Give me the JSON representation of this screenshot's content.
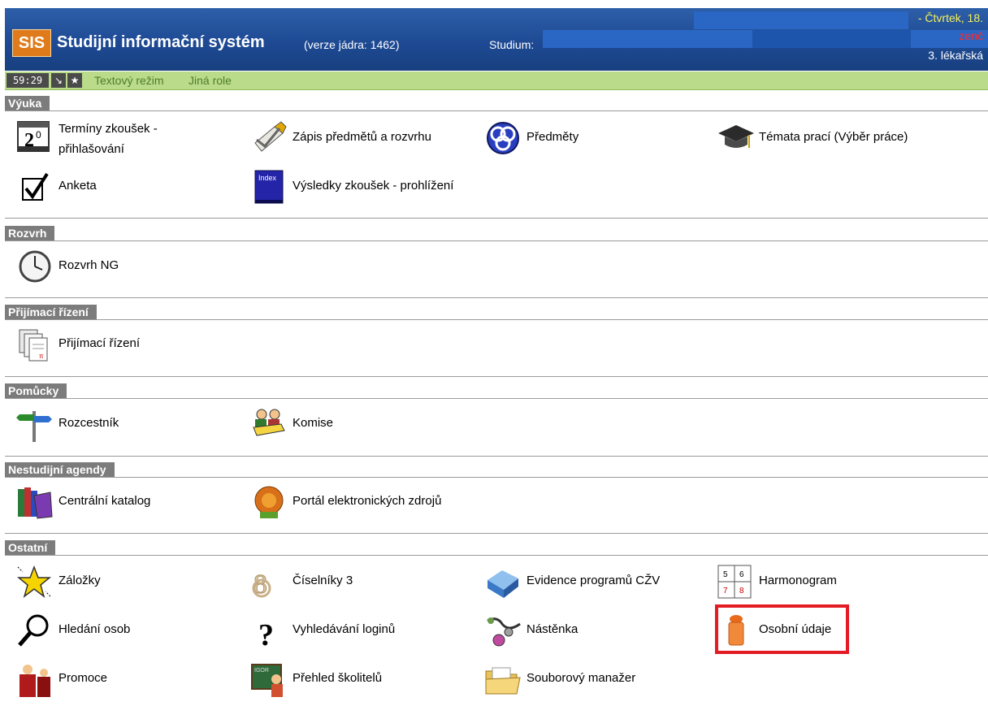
{
  "header": {
    "logo": "SIS",
    "title": "Studijní informační systém",
    "version": "(verze jádra: 1462)",
    "study_label": "Studium:",
    "date": "- Čtvrtek, 18.",
    "red_text": "zenč",
    "faculty": "3. lékařská"
  },
  "toolbar": {
    "timer": "59:29",
    "text_mode": "Textový režim",
    "other_role": "Jiná role"
  },
  "sections": {
    "vyuka": "Výuka",
    "rozvrh": "Rozvrh",
    "prijimaci": "Přijímací řízení",
    "pomucky": "Pomůcky",
    "nestudijni": "Nestudijní agendy",
    "ostatni": "Ostatní"
  },
  "items": {
    "terminy_line1": "Termíny zkoušek -",
    "terminy_line2": "přihlašování",
    "zapis": "Zápis předmětů a rozvrhu",
    "predmety": "Předměty",
    "temata": "Témata prací (Výběr práce)",
    "anketa": "Anketa",
    "vysledky": "Výsledky zkoušek - prohlížení",
    "rozvrh_ng": "Rozvrh NG",
    "prijimaci": "Přijímací řízení",
    "rozcestnik": "Rozcestník",
    "komise": "Komise",
    "katalog": "Centrální katalog",
    "portal": "Portál elektronických zdrojů",
    "zalozky": "Záložky",
    "ciselniky": "Číselníky 3",
    "evidence": "Evidence programů CŽV",
    "harmonogram": "Harmonogram",
    "hledani": "Hledání osob",
    "loginy": "Vyhledávání loginů",
    "nastenka": "Nástěnka",
    "osobni": "Osobní údaje",
    "promoce": "Promoce",
    "skolitele": "Přehled školitelů",
    "soubory": "Souborový manažer"
  },
  "icons": {
    "calendar": "calendar-icon",
    "pencil": "pencil-icon",
    "knot": "knot-icon",
    "mortarboard": "mortarboard-icon",
    "checkbox": "checkbox-icon",
    "index_book": "index-book-icon",
    "clock": "clock-icon",
    "documents": "documents-icon",
    "signpost": "signpost-icon",
    "people": "people-icon",
    "books": "books-icon",
    "portal": "portal-icon",
    "star": "star-icon",
    "numbers": "numbers-icon",
    "cube": "cube-icon",
    "harmonogram": "harmonogram-icon",
    "magnifier": "magnifier-icon",
    "question": "question-icon",
    "noticeboard": "noticeboard-icon",
    "person": "person-icon",
    "graduation": "graduation-icon",
    "teacher": "teacher-icon",
    "folder": "folder-icon"
  },
  "colors": {
    "header_blue": "#1e4a94",
    "toolbar_green": "#b9db8a",
    "section_gray": "#7c7c7c",
    "highlight_red": "#e21b24",
    "logo_orange": "#e07b1c"
  }
}
